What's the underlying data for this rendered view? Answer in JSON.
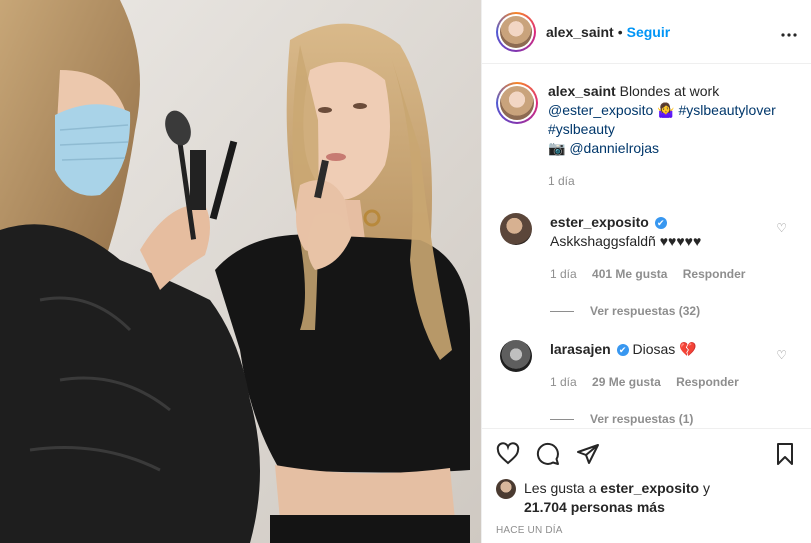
{
  "post": {
    "username": "alex_saint",
    "dot": "•",
    "follow_label": "Seguir",
    "more_icon": "⋯"
  },
  "caption": {
    "username": "alex_saint",
    "text": "Blondes at work",
    "mention": "@ester_exposito",
    "emoji": "🤷‍♀️",
    "tag1": "#yslbeautylover",
    "tag2": "#yslbeauty",
    "camera_emoji": "📷",
    "photographer": "@dannielrojas",
    "time": "1 día"
  },
  "comments": [
    {
      "username": "ester_exposito",
      "verified": "✔",
      "text": "Askkshaggsfaldñ ♥♥♥♥♥",
      "time": "1 día",
      "likes": "401 Me gusta",
      "reply": "Responder",
      "view_replies": "Ver respuestas (32)",
      "heart": "♡"
    },
    {
      "username": "larasajen",
      "verified": "✔",
      "text": "Diosas 💔",
      "time": "1 día",
      "likes": "29 Me gusta",
      "reply": "Responder",
      "view_replies": "Ver respuestas (1)",
      "heart": "♡"
    }
  ],
  "likes_line": {
    "prefix": "Les gusta a",
    "user": "ester_exposito",
    "conj": "y",
    "count": "21.704 personas más"
  },
  "timestamp": "Hace un día",
  "icons": [
    "heart-icon",
    "comment-icon",
    "share-icon",
    "bookmark-icon"
  ]
}
